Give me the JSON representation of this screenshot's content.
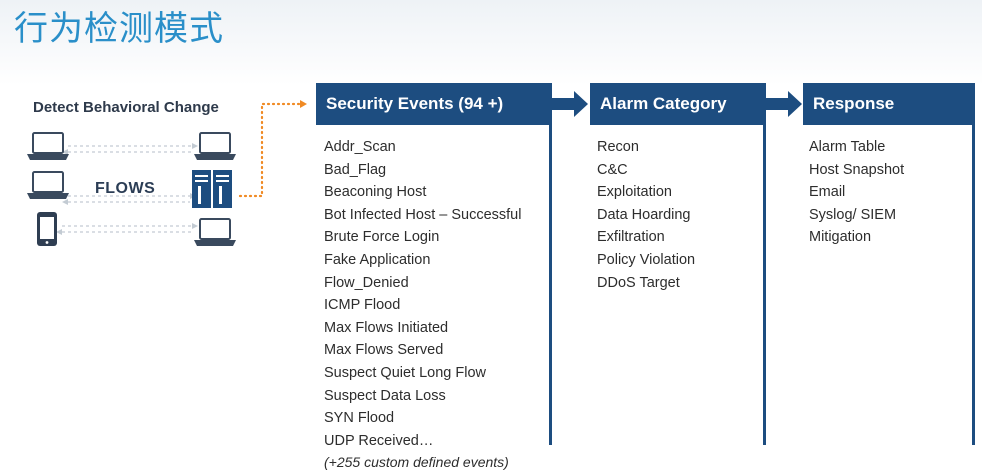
{
  "title": "行为检测模式",
  "left_panel": {
    "heading": "Detect Behavioral Change",
    "flows_label": "FLOWS",
    "icons": [
      "laptop-icon",
      "laptop-icon",
      "smartphone-icon",
      "server-icon",
      "laptop-icon",
      "laptop-icon"
    ],
    "connector_color": "#f08a24"
  },
  "columns": [
    {
      "header": "Security Events (94 +)",
      "items": [
        "Addr_Scan",
        "Bad_Flag",
        "Beaconing Host",
        "Bot Infected Host – Successful",
        "Brute Force Login",
        "Fake Application",
        "Flow_Denied",
        "ICMP Flood",
        "Max Flows Initiated",
        "Max Flows Served",
        "Suspect Quiet Long Flow",
        "Suspect Data Loss",
        "SYN Flood",
        "UDP Received…"
      ],
      "note": "(+255 custom defined events)"
    },
    {
      "header": "Alarm Category",
      "items": [
        "Recon",
        "C&C",
        "Exploitation",
        "Data Hoarding",
        "Exfiltration",
        "Policy Violation",
        "DDoS Target"
      ]
    },
    {
      "header": "Response",
      "items": [
        "Alarm Table",
        "Host Snapshot",
        "Email",
        "Syslog/ SIEM",
        "Mitigation"
      ]
    }
  ],
  "colors": {
    "header_bg": "#1d4d80",
    "title": "#2a8fc9",
    "text": "#2d2d2d"
  }
}
